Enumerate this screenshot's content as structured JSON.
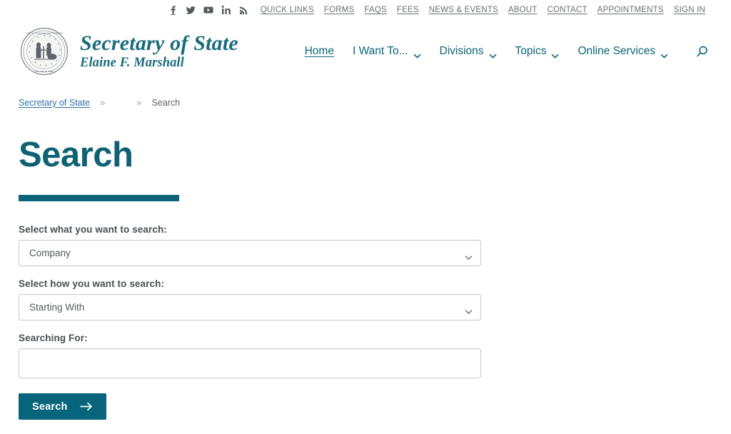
{
  "utility_bar": {
    "social": [
      {
        "name": "facebook-icon",
        "label": "f"
      },
      {
        "name": "twitter-icon",
        "label": "Twitter"
      },
      {
        "name": "youtube-icon",
        "label": "YouTube"
      },
      {
        "name": "linkedin-icon",
        "label": "in"
      },
      {
        "name": "rss-icon",
        "label": "RSS"
      }
    ],
    "links": [
      {
        "label": "QUICK LINKS"
      },
      {
        "label": "FORMS"
      },
      {
        "label": "FAQS"
      },
      {
        "label": "FEES"
      },
      {
        "label": "NEWS & EVENTS"
      },
      {
        "label": "ABOUT"
      },
      {
        "label": "CONTACT"
      },
      {
        "label": "APPOINTMENTS"
      },
      {
        "label": "SIGN IN"
      }
    ]
  },
  "brand": {
    "title": "Secretary of State",
    "subtitle": "Elaine F. Marshall",
    "seal_alt": "North Carolina Department of the Secretary of State seal"
  },
  "main_nav": {
    "items": [
      {
        "label": "Home",
        "has_chevron": false,
        "active": true
      },
      {
        "label": "I Want To...",
        "has_chevron": true,
        "active": false
      },
      {
        "label": "Divisions",
        "has_chevron": true,
        "active": false
      },
      {
        "label": "Topics",
        "has_chevron": true,
        "active": false
      },
      {
        "label": "Online Services",
        "has_chevron": true,
        "active": false
      }
    ],
    "search_icon": "search-icon"
  },
  "breadcrumb": {
    "home_label": "Secretary of State",
    "separator": "»",
    "middle_label": "",
    "current_label": "Search"
  },
  "page": {
    "title": "Search"
  },
  "form": {
    "what_label": "Select what you want to search:",
    "what_value": "Company",
    "what_options": [
      "Company"
    ],
    "how_label": "Select how you want to search:",
    "how_value": "Starting With",
    "how_options": [
      "Starting With"
    ],
    "term_label": "Searching For:",
    "term_value": "",
    "term_placeholder": "",
    "submit_label": "Search"
  },
  "colors": {
    "teal": "#0b6478",
    "button_teal": "#06657b",
    "title_teal": "#0e6273",
    "brand_teal": "#1a6b7d",
    "crumb_link": "#2f6fa8",
    "muted_text": "#6a6f73",
    "border": "#c3c7cb"
  }
}
